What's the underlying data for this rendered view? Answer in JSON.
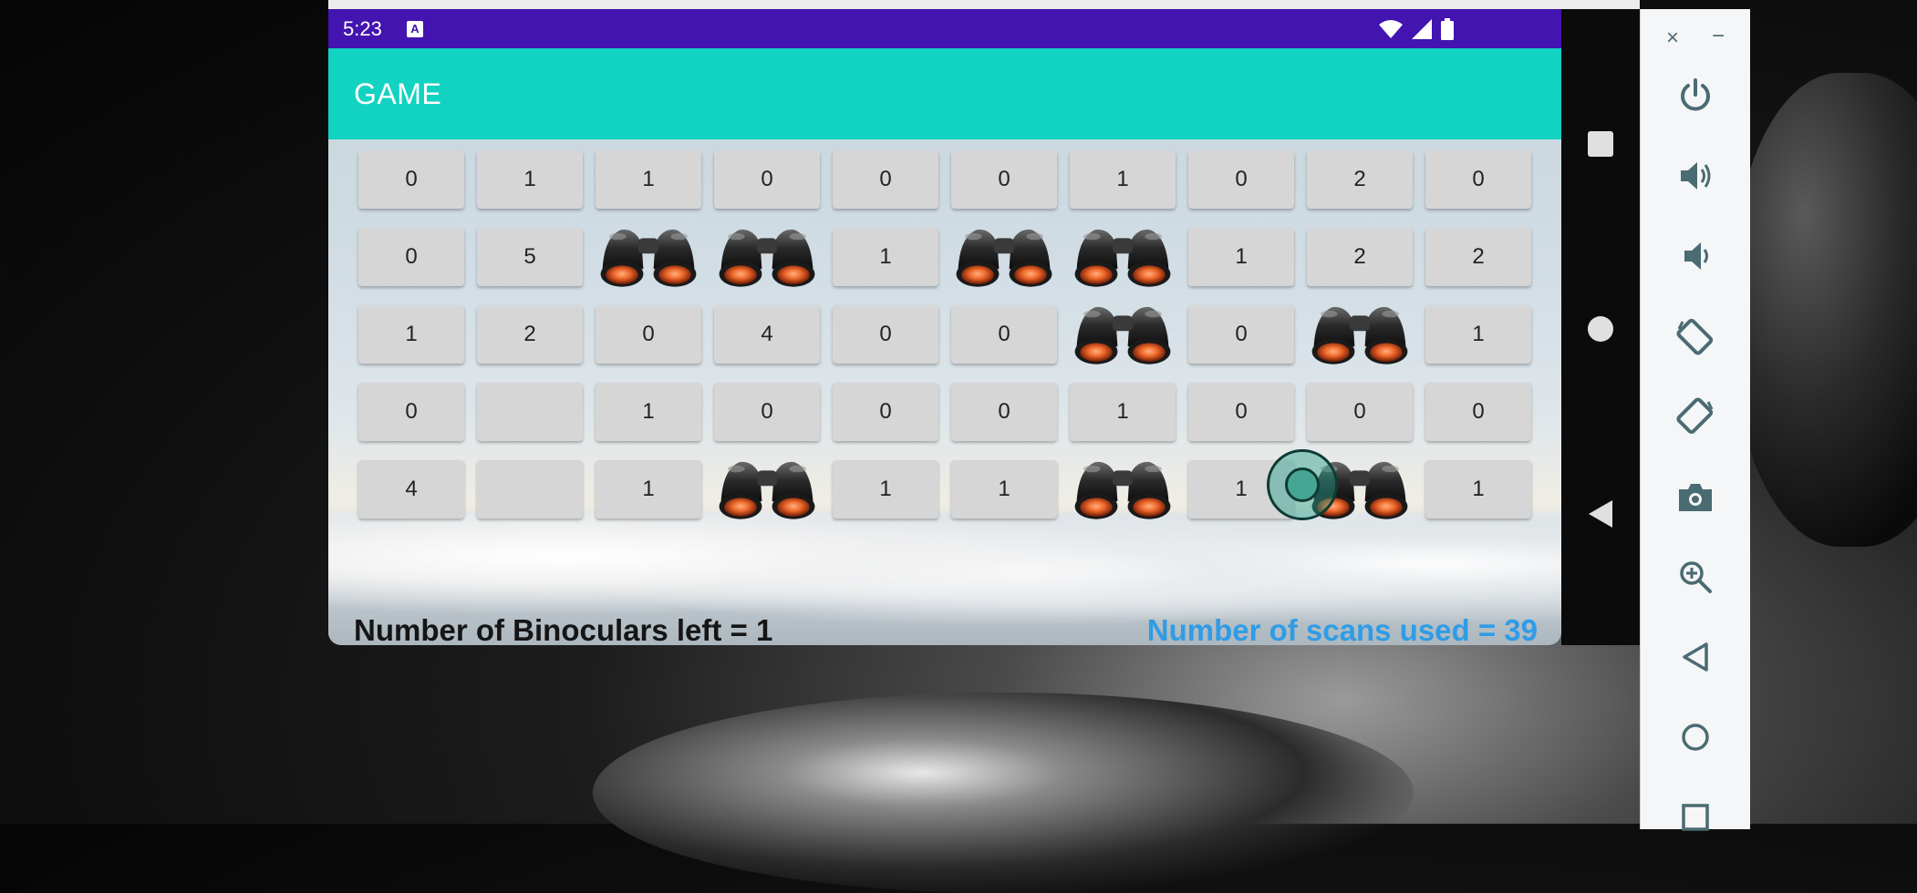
{
  "status_bar": {
    "time": "5:23",
    "notification_glyph": "A"
  },
  "app_bar": {
    "title": "GAME"
  },
  "grid": [
    [
      "0",
      "1",
      "1",
      "0",
      "0",
      "0",
      "1",
      "0",
      "2",
      "0"
    ],
    [
      "0",
      "5",
      "B",
      "B",
      "1",
      "B",
      "B",
      "1",
      "2",
      "2"
    ],
    [
      "1",
      "2",
      "0",
      "4",
      "0",
      "0",
      "B",
      "0",
      "B",
      "1"
    ],
    [
      "0",
      "",
      "1",
      "0",
      "0",
      "0",
      "1",
      "0",
      "0",
      "0"
    ],
    [
      "4",
      "",
      "1",
      "B",
      "1",
      "1",
      "B",
      "1",
      "B",
      "1"
    ]
  ],
  "footer": {
    "binoculars_left": "Number of Binoculars left = 1",
    "scans_used": "Number of scans used = 39"
  },
  "emulator_panel": {
    "close_symbol": "×",
    "minimize_symbol": "−",
    "icons": [
      "power-icon",
      "volume-up-icon",
      "volume-down-icon",
      "rotate-left-icon",
      "rotate-right-icon",
      "camera-icon",
      "zoom-icon",
      "back-icon",
      "home-icon",
      "overview-icon"
    ]
  },
  "colors": {
    "status_bar": "#4314b0",
    "app_bar": "#12d3c2",
    "scan_text": "#2f9ce6"
  }
}
